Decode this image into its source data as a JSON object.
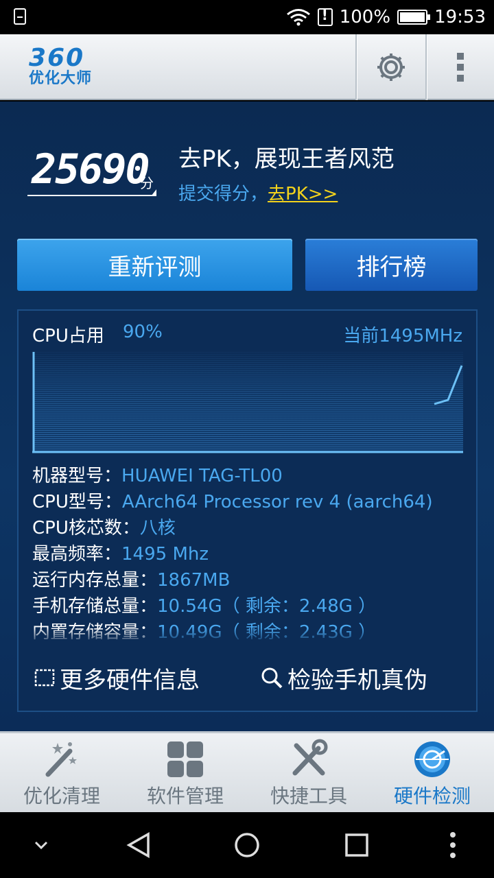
{
  "status_bar": {
    "battery": "100%",
    "time": "19:53",
    "icons": [
      "sim-icon",
      "wifi-icon",
      "no-sim-icon",
      "battery-icon"
    ]
  },
  "header": {
    "logo_number": "360",
    "logo_text": "优化大师",
    "icons": [
      "gear-icon",
      "more-vert-icon"
    ]
  },
  "score": {
    "value": "25690",
    "unit": "分",
    "pk_title": "去PK，展现王者风范",
    "pk_sub": "提交得分，",
    "pk_link": "去PK>>"
  },
  "buttons": {
    "retest": "重新评测",
    "ranking": "排行榜"
  },
  "cpu": {
    "label": "CPU占用",
    "usage": "90%",
    "frequency": "当前1495MHz"
  },
  "specs": [
    {
      "label": "机器型号：",
      "value": "HUAWEI TAG-TL00"
    },
    {
      "label": "CPU型号：",
      "value": "AArch64 Processor rev 4 (aarch64)"
    },
    {
      "label": "CPU核芯数：",
      "value": "八核"
    },
    {
      "label": "最高频率：",
      "value": "1495 Mhz"
    },
    {
      "label": "运行内存总量：",
      "value": "1867MB"
    },
    {
      "label": "手机存储总量：",
      "value": "10.54G（ 剩余：2.48G ）"
    },
    {
      "label": "内置存储容量：",
      "value": "10.49G（ 剩余：2.43G ）"
    }
  ],
  "links": {
    "more_hardware": "更多硬件信息",
    "check_phone": "检验手机真伪"
  },
  "tabs": [
    {
      "label": "优化清理",
      "icon": "magic-wand-icon",
      "active": false
    },
    {
      "label": "软件管理",
      "icon": "apps-grid-icon",
      "active": false
    },
    {
      "label": "快捷工具",
      "icon": "tools-icon",
      "active": false
    },
    {
      "label": "硬件检测",
      "icon": "radar-icon",
      "active": true
    }
  ],
  "colors": {
    "accent": "#4aa8ef",
    "link_yellow": "#f3d21c",
    "panel_bg": "#0c2c56",
    "active_tab": "#1a78c8"
  }
}
